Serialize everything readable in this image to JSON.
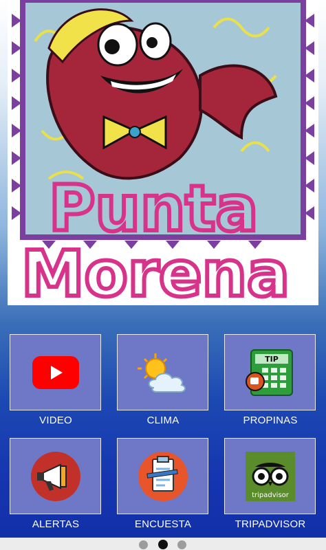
{
  "logo": {
    "line1": "Punta",
    "line2": "Morena"
  },
  "menu": [
    {
      "label": "VIDEO",
      "icon": "youtube-play-icon"
    },
    {
      "label": "CLIMA",
      "icon": "weather-sun-cloud-icon"
    },
    {
      "label": "PROPINAS",
      "icon": "tip-calculator-icon"
    },
    {
      "label": "ALERTAS",
      "icon": "megaphone-icon"
    },
    {
      "label": "ENCUESTA",
      "icon": "survey-clipboard-icon"
    },
    {
      "label": "TRIPADVISOR",
      "icon": "tripadvisor-owl-icon",
      "icon_text": "tripadvisor"
    }
  ],
  "tip_icon_text": "TIP",
  "pager": {
    "pages": 3,
    "active": 2
  },
  "colors": {
    "tile": "#6f78c6",
    "logo_pink": "#d8338a",
    "fish_red": "#a5263a"
  }
}
